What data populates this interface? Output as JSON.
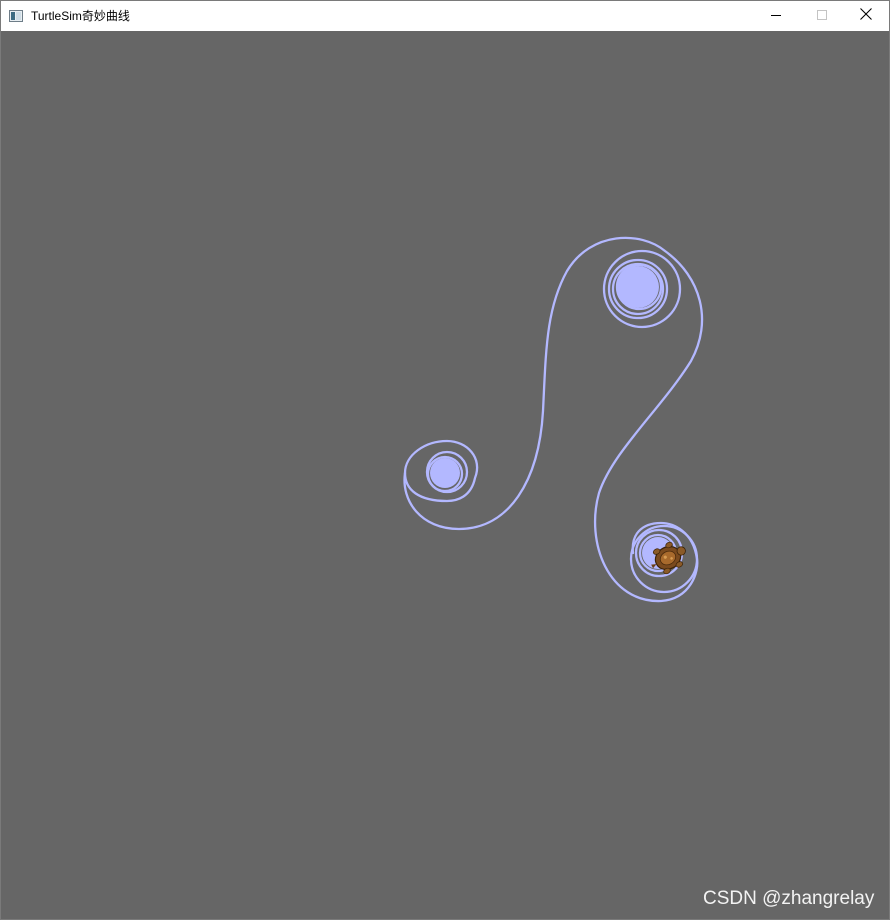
{
  "window": {
    "title": "TurtleSim奇妙曲线",
    "icon": "app-window-icon",
    "controls": {
      "minimize_icon": "minimize-icon",
      "maximize_icon": "maximize-icon",
      "close_icon": "close-icon"
    }
  },
  "canvas": {
    "background_color": "#666666",
    "pen_color": "#b3b8ff",
    "turtle_icon": "turtle-icon"
  },
  "watermark": {
    "text": "CSDN @zhangrelay"
  }
}
